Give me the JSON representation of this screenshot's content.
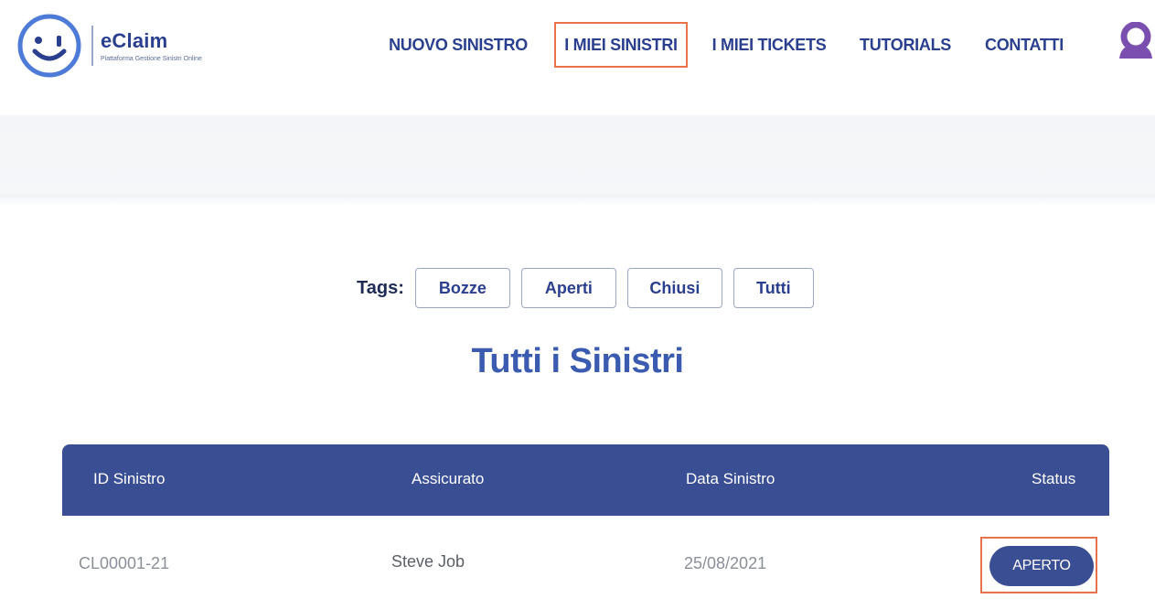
{
  "brand": {
    "name": "eClaim",
    "tagline": "Piattaforma Gestione Sinistri Online",
    "color": "#2b3f8f",
    "accent": "#4f7bd8"
  },
  "nav": {
    "items": [
      {
        "label": "NUOVO SINISTRO",
        "active": false
      },
      {
        "label": "I MIEI SINISTRI",
        "active": true
      },
      {
        "label": "I MIEI TICKETS",
        "active": false
      },
      {
        "label": "TUTORIALS",
        "active": false
      },
      {
        "label": "CONTATTI",
        "active": false
      }
    ],
    "highlight_color": "#e8734a"
  },
  "user": {
    "avatar_icon": "user-avatar-icon",
    "avatar_color": "#7b4fb0"
  },
  "tags": {
    "label": "Tags:",
    "items": [
      "Bozze",
      "Aperti",
      "Chiusi",
      "Tutti"
    ]
  },
  "page_title": "Tutti i Sinistri",
  "table": {
    "header_color": "#3a4e94",
    "columns": [
      "ID Sinistro",
      "Assicurato",
      "Data Sinistro",
      "Status"
    ],
    "rows": [
      {
        "id": "CL00001-21",
        "insured": "Steve Job",
        "date": "25/08/2021",
        "status": "APERTO"
      }
    ]
  }
}
